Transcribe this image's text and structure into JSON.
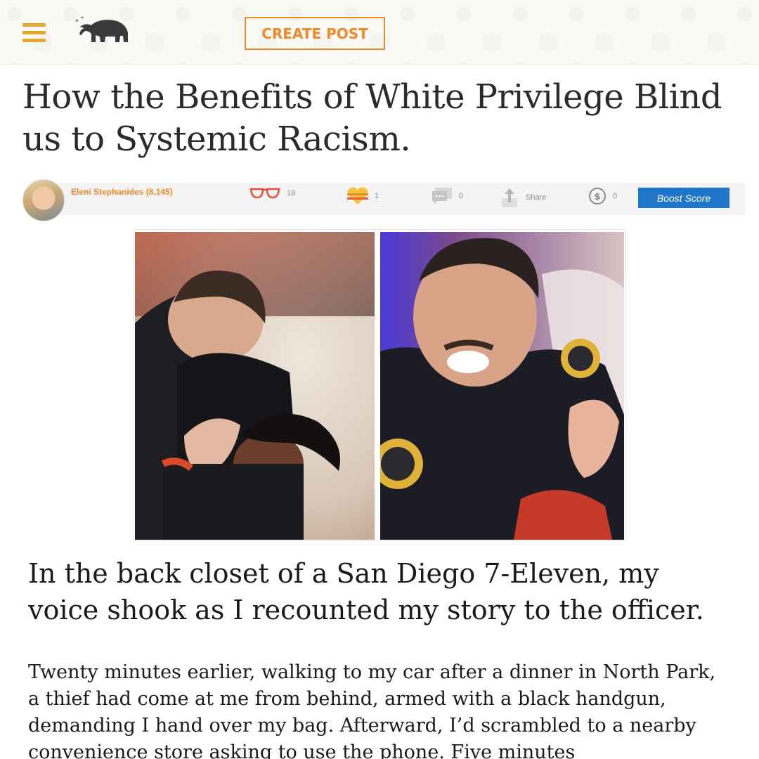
{
  "header": {
    "menu_icon": "hamburger-menu-icon",
    "logo_icon": "elephant-logo-icon",
    "create_post_label": "CREATE POST",
    "accent_color": "#ef8a2a",
    "menu_color": "#e7a82f"
  },
  "article": {
    "title": "How the Benefits of White Privilege Blind us to Systemic Racism.",
    "author": "Eleni Stephanides (8,145)",
    "stats": {
      "reads": "18",
      "hearts": "1",
      "comments": "0",
      "share_label": "Share",
      "tips": "0"
    },
    "boost_label": "Boost Score",
    "boost_color": "#1f76c8",
    "lead": "In the back closet of a San Diego 7-Eleven, my voice shook as I recounted my story to the officer.",
    "paragraph": "Twenty minutes earlier, walking to my car after a dinner in North Park, a thief had come at me from behind, armed with a black handgun, demanding I hand over my bag. Afterward, I’d scrambled to a nearby convenience store asking to use the phone. Five minutes"
  }
}
